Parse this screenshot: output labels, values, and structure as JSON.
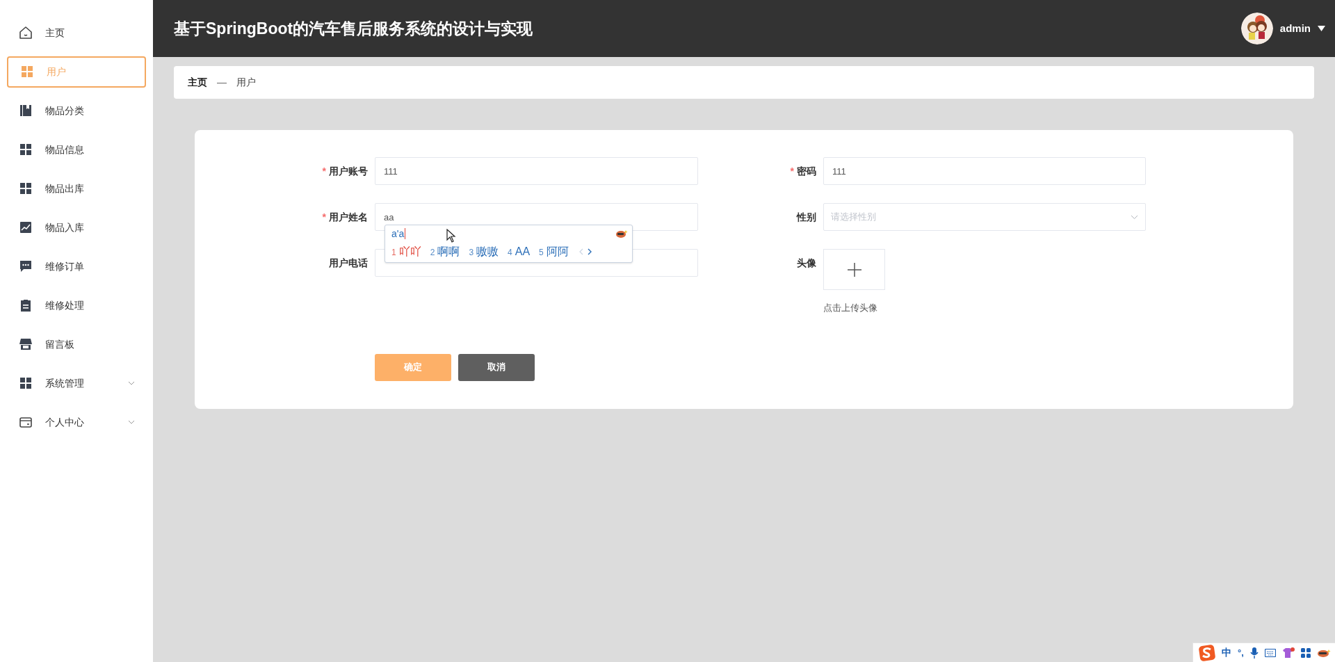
{
  "sidebar": {
    "items": [
      {
        "label": "主页",
        "kind": "link",
        "selected": false
      },
      {
        "label": "用户",
        "kind": "link",
        "selected": true
      },
      {
        "label": "物品分类",
        "kind": "link",
        "selected": false
      },
      {
        "label": "物品信息",
        "kind": "link",
        "selected": false
      },
      {
        "label": "物品出库",
        "kind": "link",
        "selected": false
      },
      {
        "label": "物品入库",
        "kind": "link",
        "selected": false
      },
      {
        "label": "维修订单",
        "kind": "link",
        "selected": false
      },
      {
        "label": "维修处理",
        "kind": "link",
        "selected": false
      },
      {
        "label": "留言板",
        "kind": "link",
        "selected": false
      },
      {
        "label": "系统管理",
        "kind": "group",
        "selected": false
      },
      {
        "label": "个人中心",
        "kind": "group",
        "selected": false
      }
    ]
  },
  "header": {
    "title": "基于SpringBoot的汽车售后服务系统的设计与实现",
    "user": {
      "name": "admin"
    }
  },
  "breadcrumb": {
    "items": [
      "主页",
      "用户"
    ],
    "separator": "—"
  },
  "form": {
    "required_mark": "*",
    "fields": [
      {
        "label": "用户账号",
        "kind": "text",
        "required": true,
        "value": "111"
      },
      {
        "label": "密码",
        "kind": "text",
        "required": true,
        "value": "111"
      },
      {
        "label": "用户姓名",
        "kind": "text",
        "required": true,
        "value": "aa"
      },
      {
        "label": "性别",
        "kind": "select",
        "required": false,
        "placeholder": "请选择性别"
      },
      {
        "label": "用户电话",
        "kind": "text",
        "required": false
      },
      {
        "label": "头像",
        "kind": "upload",
        "required": false,
        "hint": "点击上传头像"
      }
    ],
    "buttons": [
      {
        "label": "确定",
        "kind": "primary"
      },
      {
        "label": "取消",
        "kind": "secondary"
      }
    ]
  },
  "ime_popup": {
    "composition": "a'a",
    "candidates": [
      {
        "number": "1",
        "text": "吖吖",
        "selected": true
      },
      {
        "number": "2",
        "text": "啊啊",
        "selected": false
      },
      {
        "number": "3",
        "text": "嗷嗷",
        "selected": false
      },
      {
        "number": "4",
        "text": "AA",
        "selected": false
      },
      {
        "number": "5",
        "text": "阿阿",
        "selected": false
      }
    ]
  },
  "ime_toolbar": {
    "mode": "中",
    "punctuation": "°,"
  }
}
